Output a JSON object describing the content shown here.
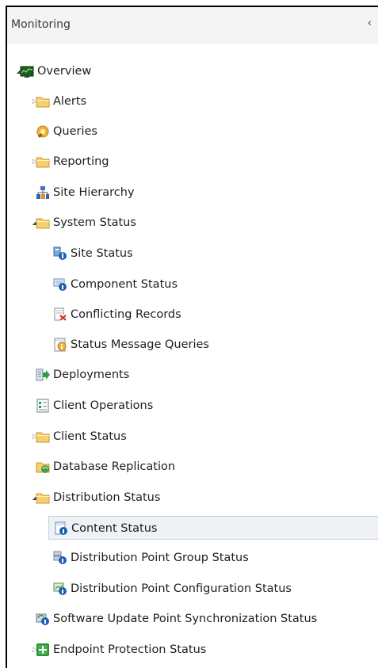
{
  "pane": {
    "title": "Monitoring",
    "collapse_glyph": "‹"
  },
  "tree": [
    {
      "label": "Overview",
      "toggle": "expanded",
      "icon": "overview-icon"
    },
    {
      "label": "Alerts",
      "toggle": "collapsed",
      "icon": "folder-icon"
    },
    {
      "label": "Queries",
      "toggle": "none",
      "icon": "queries-icon"
    },
    {
      "label": "Reporting",
      "toggle": "collapsed",
      "icon": "folder-icon"
    },
    {
      "label": "Site Hierarchy",
      "toggle": "none",
      "icon": "site-hierarchy-icon"
    },
    {
      "label": "System Status",
      "toggle": "expanded",
      "icon": "folder-icon"
    },
    {
      "label": "Site Status",
      "toggle": "none",
      "icon": "site-status-icon"
    },
    {
      "label": "Component Status",
      "toggle": "none",
      "icon": "component-status-icon"
    },
    {
      "label": "Conflicting Records",
      "toggle": "none",
      "icon": "conflicting-records-icon"
    },
    {
      "label": "Status Message Queries",
      "toggle": "none",
      "icon": "status-message-queries-icon"
    },
    {
      "label": "Deployments",
      "toggle": "none",
      "icon": "deployments-icon"
    },
    {
      "label": "Client Operations",
      "toggle": "none",
      "icon": "client-operations-icon"
    },
    {
      "label": "Client Status",
      "toggle": "collapsed",
      "icon": "folder-icon"
    },
    {
      "label": "Database Replication",
      "toggle": "none",
      "icon": "database-replication-icon"
    },
    {
      "label": "Distribution Status",
      "toggle": "expanded",
      "icon": "folder-icon"
    },
    {
      "label": "Content Status",
      "toggle": "none",
      "icon": "content-status-icon",
      "selected": true
    },
    {
      "label": "Distribution Point Group Status",
      "toggle": "none",
      "icon": "dp-group-status-icon"
    },
    {
      "label": "Distribution Point Configuration Status",
      "toggle": "none",
      "icon": "dp-configuration-status-icon"
    },
    {
      "label": "Software Update Point Synchronization Status",
      "toggle": "none",
      "icon": "sup-sync-status-icon"
    },
    {
      "label": "Endpoint Protection Status",
      "toggle": "collapsed",
      "icon": "endpoint-protection-icon"
    }
  ]
}
